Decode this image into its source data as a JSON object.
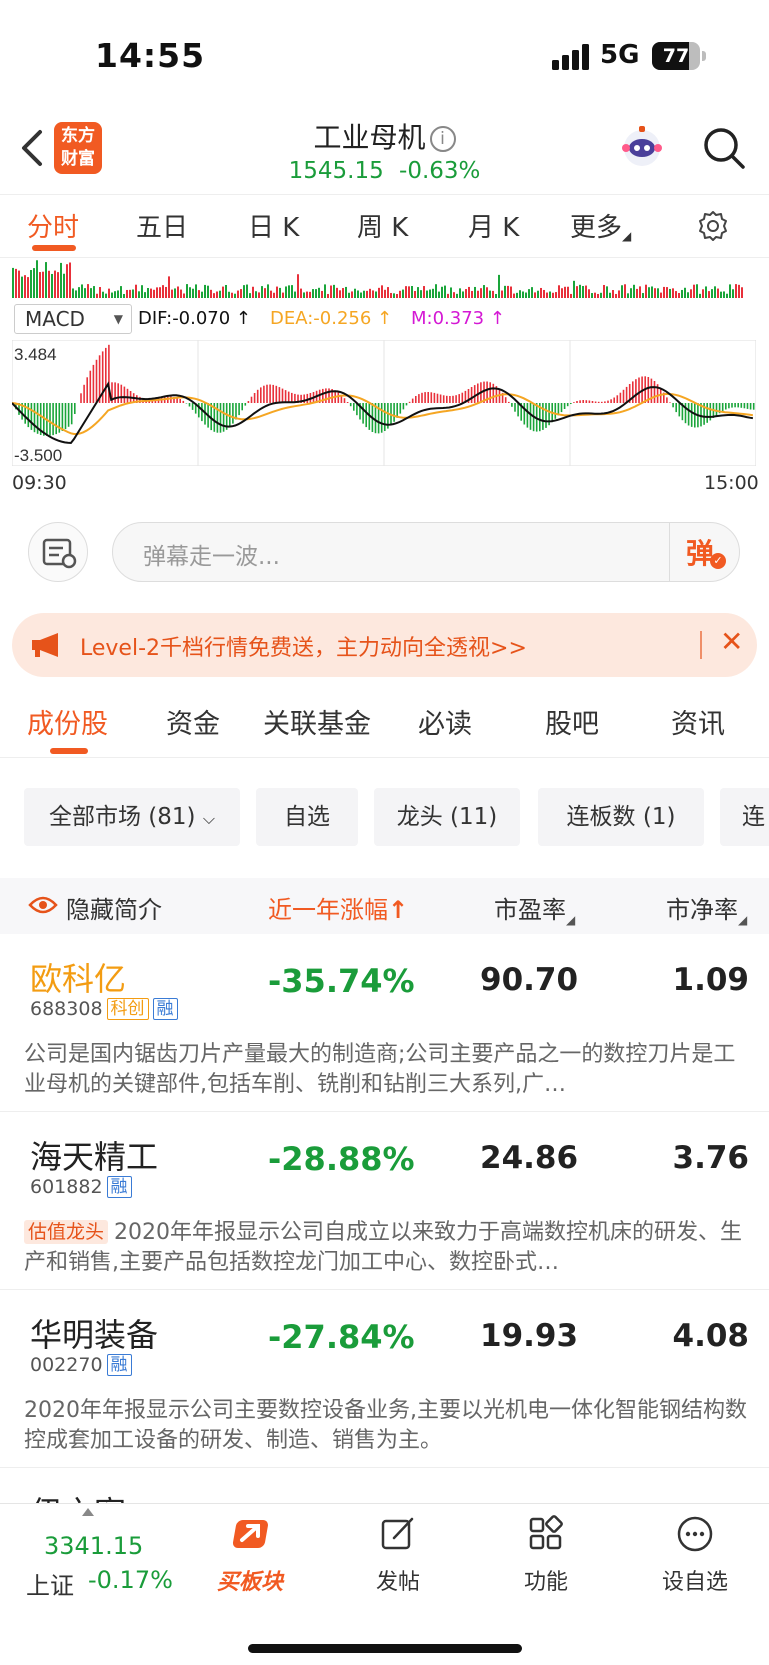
{
  "status_bar": {
    "time": "14:55",
    "network": "5G",
    "battery": "77",
    "battery_level_pct": 77
  },
  "nav": {
    "logo": "东方财富",
    "title": "工业母机",
    "info_glyph": "i",
    "price": "1545.15",
    "change": "-0.63%"
  },
  "chart_tabs": [
    "分时",
    "五日",
    "日 K",
    "周 K",
    "月 K",
    "更多"
  ],
  "chart": {
    "indicator": "MACD",
    "dif": "DIF:-0.070 ↑",
    "dea": "DEA:-0.256 ↑",
    "m": "M:0.373 ↑",
    "y_max_label": "3.484",
    "y_min_label": "-3.500",
    "start_time": "09:30",
    "end_time": "15:00",
    "colors": {
      "up": "#e8303a",
      "down": "#1aa53a",
      "dif": "#111111",
      "dea": "#f5a623",
      "m": "#d418d4"
    }
  },
  "danmaku": {
    "placeholder": "弹幕走一波...",
    "send_label": "弹"
  },
  "promo": {
    "text": "Level-2千档行情免费送，主力动向全透视>>",
    "close": "✕"
  },
  "section_tabs": [
    "成份股",
    "资金",
    "关联基金",
    "必读",
    "股吧",
    "资讯"
  ],
  "filters": [
    "全部市场 (81)",
    "自选",
    "龙头 (11)",
    "连板数 (1)",
    "连"
  ],
  "table_header": {
    "toggle": "隐藏简介",
    "col1": "近一年涨幅",
    "col1_arrow": "↑",
    "col2": "市盈率",
    "col3": "市净率"
  },
  "stocks": [
    {
      "name": "欧科亿",
      "code": "688308",
      "tags": [
        "科创",
        "融"
      ],
      "change": "-35.74%",
      "pe": "90.70",
      "pb": "1.09",
      "desc_tag": "",
      "desc": "公司是国内锯齿刀片产量最大的制造商;公司主要产品之一的数控刀片是工业母机的关键部件,包括车削、铣削和钻削三大系列,广…"
    },
    {
      "name": "海天精工",
      "code": "601882",
      "tags": [
        "融"
      ],
      "change": "-28.88%",
      "pe": "24.86",
      "pb": "3.76",
      "desc_tag": "估值龙头",
      "desc": "2020年年报显示公司自成立以来致力于高端数控机床的研发、生产和销售,主要产品包括数控龙门加工中心、数控卧式…"
    },
    {
      "name": "华明装备",
      "code": "002270",
      "tags": [
        "融"
      ],
      "change": "-27.84%",
      "pe": "19.93",
      "pb": "4.08",
      "desc_tag": "",
      "desc": "2020年年报显示公司主要数控设备业务,主要以光机电一体化智能钢结构数控成套加工设备的研发、制造、销售为主。"
    },
    {
      "name": "伊之密",
      "code": "",
      "tags": [],
      "change": "",
      "pe": "",
      "pb": "",
      "desc_tag": "",
      "desc": ""
    }
  ],
  "bottom_bar": {
    "index_price": "3341.15",
    "index_name": "上证",
    "index_change": "-0.17%",
    "items": [
      "买板块",
      "发帖",
      "功能",
      "设自选"
    ]
  }
}
